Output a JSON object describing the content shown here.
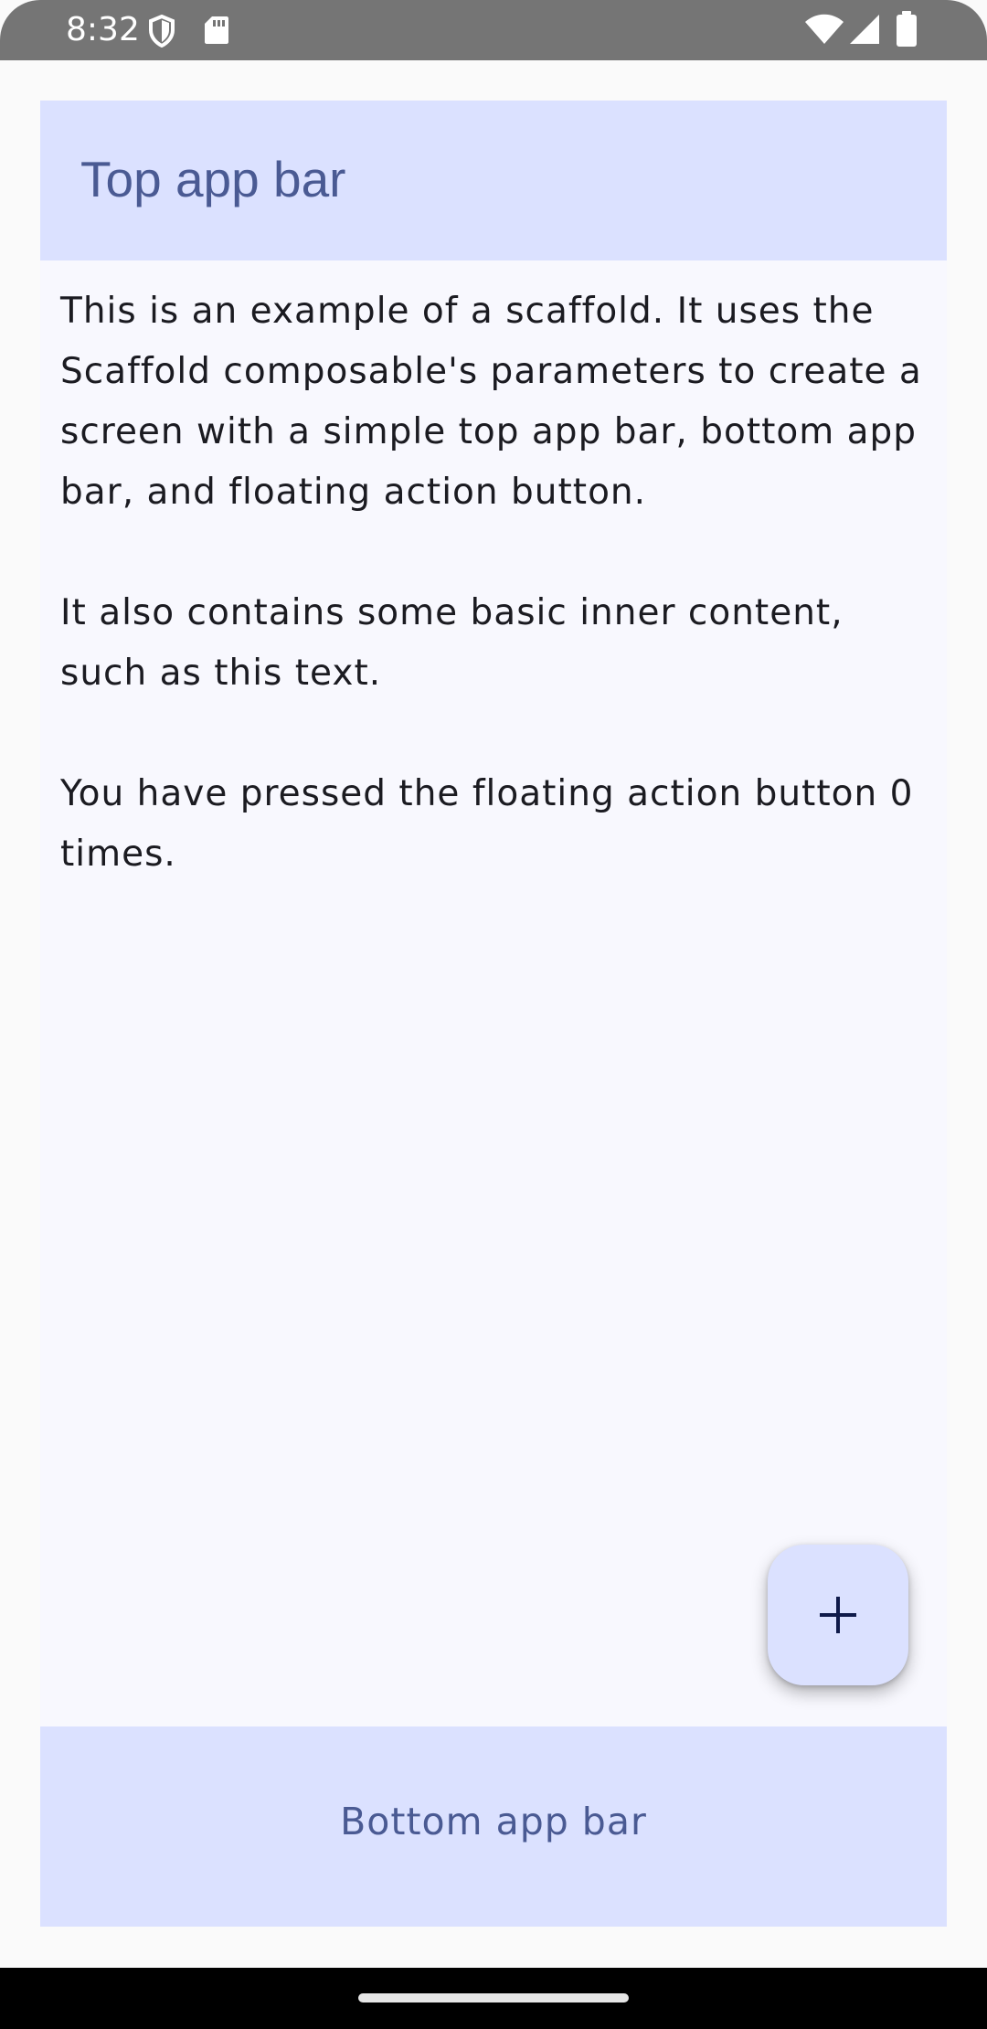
{
  "status_bar": {
    "time": "8:32",
    "left_icons": [
      "shield-icon",
      "sd-card-icon"
    ],
    "right_icons": [
      "wifi-icon",
      "signal-icon",
      "battery-icon"
    ]
  },
  "top_app_bar": {
    "title": "Top app bar"
  },
  "content": {
    "paragraph_1": "This is an example of a scaffold. It uses the Scaffold composable's parameters to create a screen with a simple top app bar, bottom app bar, and floating action button.",
    "paragraph_2": "It also contains some basic inner content, such as this text.",
    "paragraph_3": "You have pressed the floating action button 0 times."
  },
  "fab": {
    "icon": "add-icon"
  },
  "bottom_app_bar": {
    "label": "Bottom app bar"
  },
  "colors": {
    "bar_background": "#dbe1ff",
    "bar_text": "#4a5a93",
    "content_background": "#f8f8fe",
    "body_text": "#1b1b21"
  }
}
